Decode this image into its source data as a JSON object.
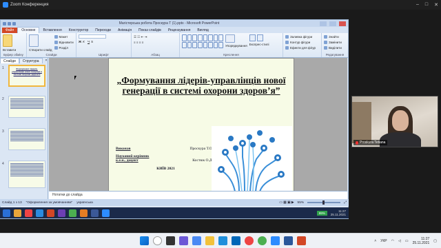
{
  "zoom": {
    "title": "Zoom Конференция"
  },
  "ppt": {
    "window_title": "Магістерська робота Проскура Т (1).pptx - Microsoft PowerPoint",
    "tabs": [
      "Файл",
      "Основне",
      "Вставлення",
      "Конструктор",
      "Переходи",
      "Анімація",
      "Показ слайдів",
      "Рецензування",
      "Вигляд"
    ],
    "ribbon": {
      "paste": "Вставити",
      "create_slide": "Створити слайд",
      "layout": "Макет",
      "reset": "Відновити",
      "section": "Розділ",
      "groups": [
        "Буфер обміну",
        "Слайди",
        "Шрифт",
        "Абзац",
        "Креслення",
        "Редагування"
      ],
      "arrange": "Упорядкування",
      "quick_styles": "Експрес-стилі",
      "shape_fill": "Заливка фігури",
      "shape_outline": "Контур фігури",
      "shape_effects": "Ефекти для фігур",
      "find": "Знайти",
      "replace": "Замінити",
      "select": "Виділити"
    },
    "panel_tabs": [
      "Слайди",
      "Структура"
    ],
    "notes": "Нотатки до слайда",
    "status": {
      "slide": "Слайд 1 з 13",
      "theme": "\"Оформлення за умовчанням\"",
      "lang": "українська",
      "zoom": "55%"
    }
  },
  "slide": {
    "title": "„Формування лідерів-управлінців нової генерації в системі охорони здоров’я”",
    "performer_label": "Виконав",
    "performer_name": "Проскура Т.О.",
    "supervisor_label": "Науковий керівник",
    "supervisor_degree": "к.е.н., доцент",
    "supervisor_name": "Костюк О.Д.",
    "city": "КИЇВ 2021"
  },
  "thumbs": [
    {
      "num": "1",
      "title": "Формування лідерів-управлінців нової генерації в системі охорони здоров’я"
    },
    {
      "num": "2",
      "title": ""
    },
    {
      "num": "3",
      "title": ""
    },
    {
      "num": "4",
      "title": ""
    }
  ],
  "remote_tray": {
    "time": "11:27",
    "date": "25.11.2021",
    "battery": "99%"
  },
  "participant": {
    "name": "Proskura Tetiana"
  },
  "taskbar": {
    "lang": "УКР",
    "time": "11:27",
    "date": "25.11.2021"
  }
}
